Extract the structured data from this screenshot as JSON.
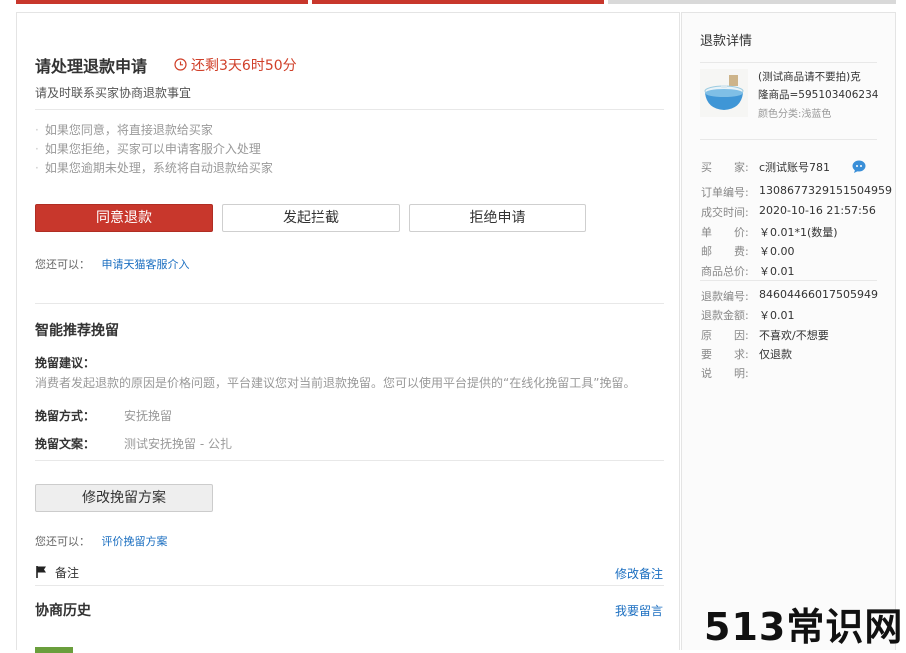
{
  "colors": {
    "accent_red": "#c8372c",
    "link_blue": "#1a6ec0",
    "countdown": "#d0402a"
  },
  "main": {
    "title": "请处理退款申请",
    "countdown": "还剩3天6时50分",
    "subtitle": "请及时联系买家协商退款事宜",
    "notes": [
      "如果您同意，将直接退款给买家",
      "如果您拒绝，买家可以申请客服介入处理",
      "如果您逾期未处理，系统将自动退款给买家"
    ],
    "buttons": {
      "agree": "同意退款",
      "intercept": "发起拦截",
      "reject": "拒绝申请"
    },
    "also_label": "您还可以：",
    "also_link": "申请天猫客服介入",
    "retain": {
      "title": "智能推荐挽留",
      "advice_label": "挽留建议：",
      "advice_text": "消费者发起退款的原因是价格问题，平台建议您对当前退款挽留。您可以使用平台提供的“在线化挽留工具”挽留。",
      "method_label": "挽留方式：",
      "method_value": "安抚挽留",
      "copy_label": "挽留文案：",
      "copy_value": "测试安抚挽留 - 公扎",
      "modify_button": "修改挽留方案",
      "also_label": "您还可以：",
      "also_link": "评价挽留方案"
    },
    "remark_label": "备注",
    "remark_link": "修改备注",
    "history_title": "协商历史",
    "history_link": "我要留言"
  },
  "side": {
    "title": "退款详情",
    "product_name_line1": "(测试商品请不要拍)克",
    "product_name_line2": "隆商品=595103406234",
    "product_color": "颜色分类:浅蓝色",
    "buyer_label": "买　　家:",
    "buyer_value": "c测试账号781",
    "order_label": "订单编号:",
    "order_value": "1308677329151504959",
    "deal_time_label": "成交时间:",
    "deal_time_value": "2020-10-16 21:57:56",
    "price_label": "单　　价:",
    "price_value": "￥0.01*1(数量)",
    "postage_label": "邮　　费:",
    "postage_value": "￥0.00",
    "total_label": "商品总价:",
    "total_value": "￥0.01",
    "refund_no_label": "退款编号:",
    "refund_no_value": "84604466017505949",
    "refund_amount_label": "退款金额:",
    "refund_amount_value": "￥0.01",
    "reason_label": "原　　因:",
    "reason_value": "不喜欢/不想要",
    "request_label": "要　　求:",
    "request_value": "仅退款",
    "explain_label": "说　　明:"
  },
  "watermark": "513常识网"
}
